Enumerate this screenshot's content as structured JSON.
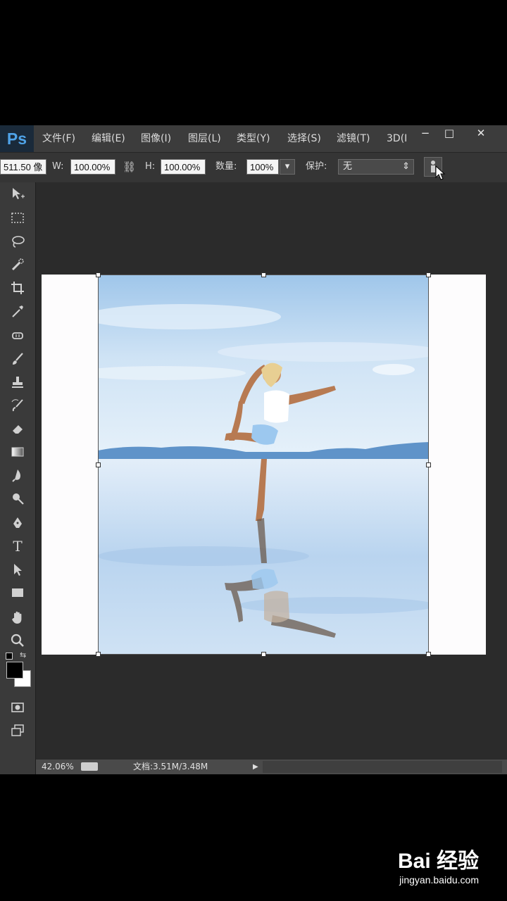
{
  "app": {
    "logo": "Ps"
  },
  "menu": {
    "items": [
      "文件(F)",
      "编辑(E)",
      "图像(I)",
      "图层(L)",
      "类型(Y)",
      "选择(S)",
      "滤镜(T)",
      "3D(I"
    ]
  },
  "window_controls": {
    "minimize": "−",
    "maximize": "□",
    "close": "✕"
  },
  "options": {
    "x_value": "511.50 像",
    "w_label": "W:",
    "w_value": "100.00%",
    "h_label": "H:",
    "h_value": "100.00%",
    "amount_label": "数量:",
    "amount_value": "100%",
    "protect_label": "保护:",
    "protect_value": "无"
  },
  "tools": [
    "move-icon",
    "marquee-icon",
    "lasso-icon",
    "quick-select-icon",
    "crop-icon",
    "eyedropper-icon",
    "healing-icon",
    "brush-icon",
    "stamp-icon",
    "history-brush-icon",
    "eraser-icon",
    "gradient-icon",
    "blur-icon",
    "dodge-icon",
    "pen-icon",
    "type-icon",
    "path-select-icon",
    "rectangle-icon",
    "hand-icon",
    "zoom-icon"
  ],
  "status": {
    "zoom": "42.06%",
    "doc_info": "文档:3.51M/3.48M"
  },
  "watermark": {
    "logo": "Bai 经验",
    "url": "jingyan.baidu.com"
  },
  "colors": {
    "ps_blue": "#4fa3e8",
    "panel": "#3a3a3a",
    "canvas_bg": "#2b2b2b"
  }
}
